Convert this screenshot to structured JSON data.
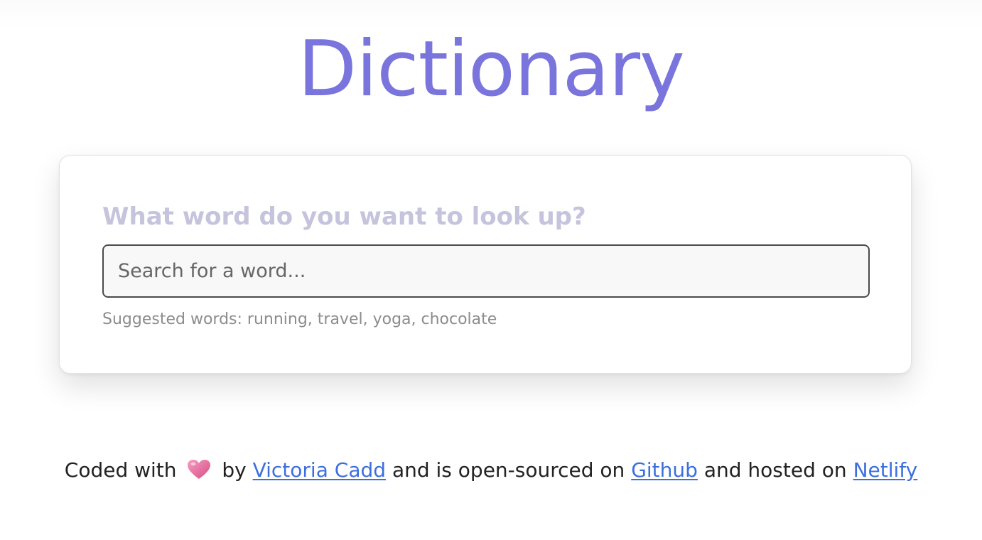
{
  "header": {
    "title": "Dictionary"
  },
  "search": {
    "prompt": "What word do you want to look up?",
    "placeholder": "Search for a word...",
    "value": "",
    "hint": "Suggested words: running, travel, yoga, chocolate"
  },
  "footer": {
    "text_before": "Coded with",
    "heart_icon": "heart-icon",
    "text_by": "by",
    "author_link": "Victoria Cadd",
    "text_middle": "and is open-sourced on",
    "github_link": "Github",
    "text_hosted": "and hosted on",
    "netlify_link": "Netlify"
  },
  "colors": {
    "title": "#7a74dd",
    "prompt": "#c6c3dd",
    "link": "#3b6fe0",
    "heart": "#e8689a"
  }
}
